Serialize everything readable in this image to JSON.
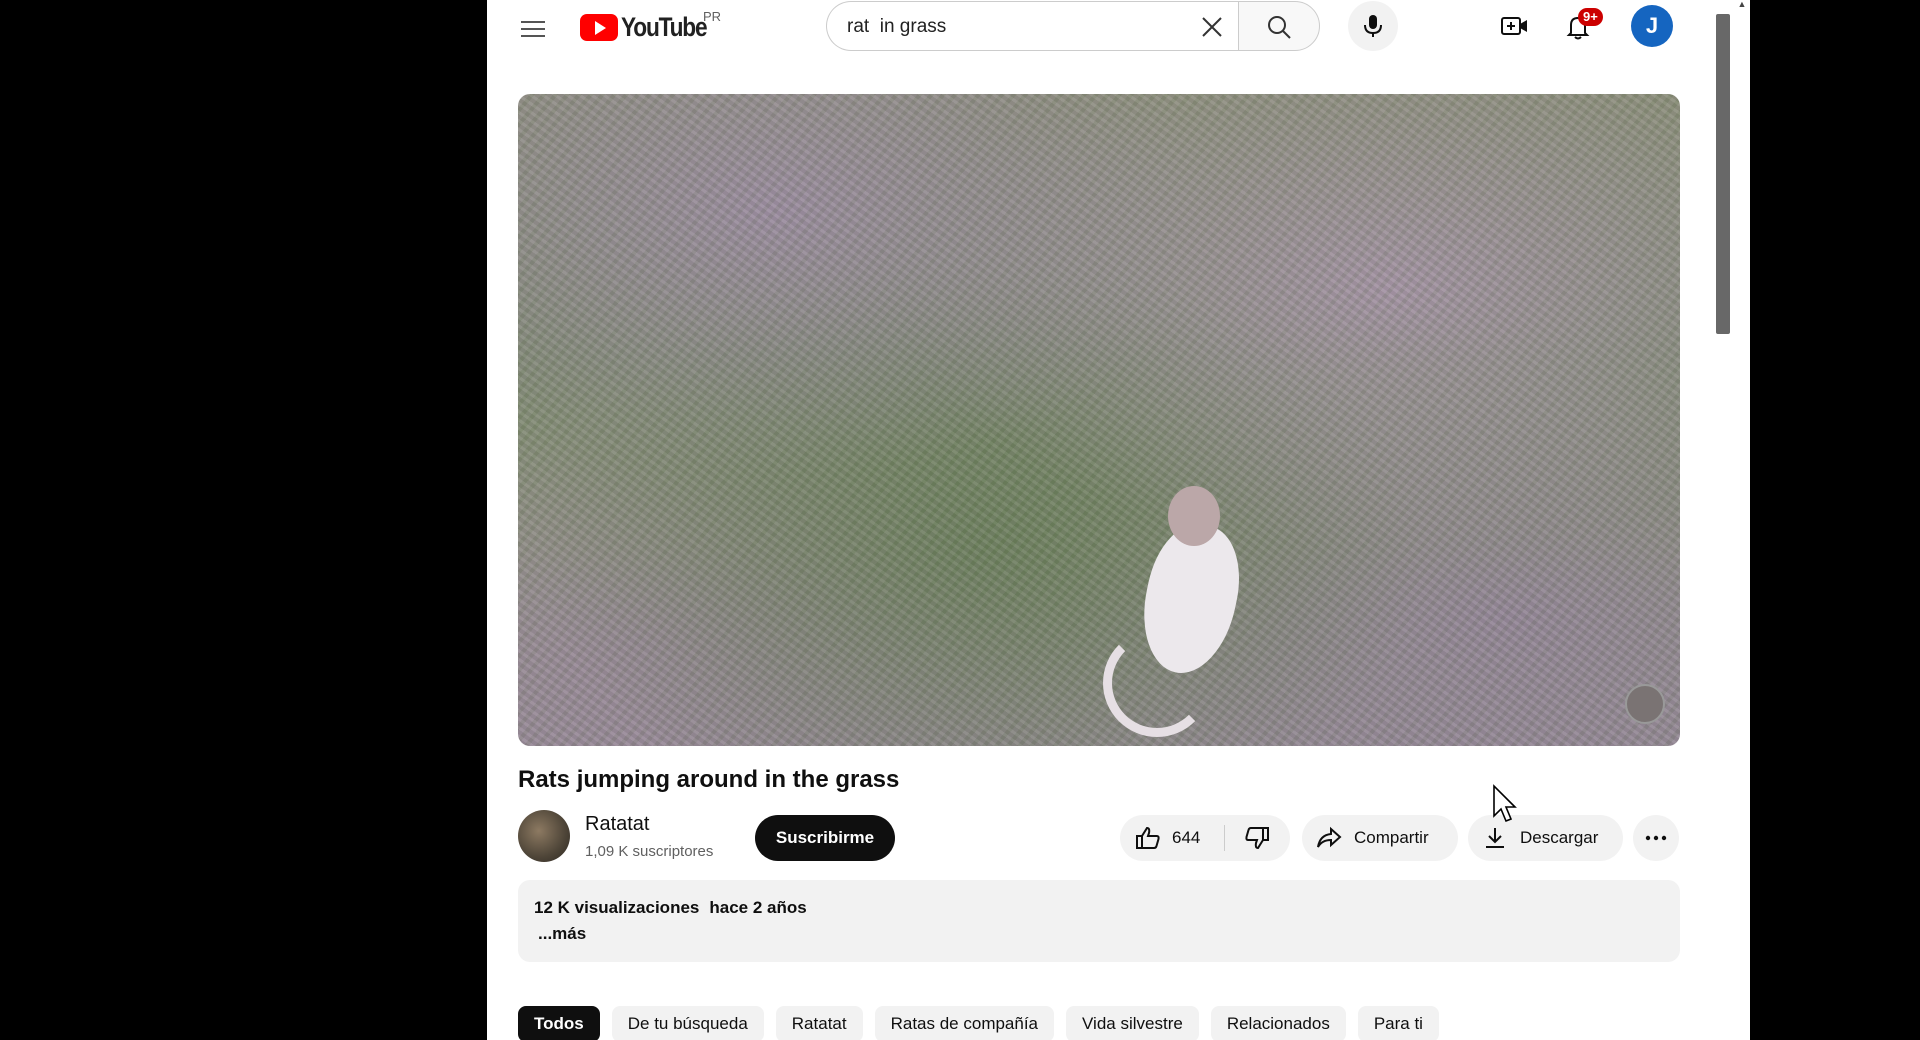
{
  "header": {
    "logo_text": "YouTube",
    "country_code": "PR",
    "search_value": "rat  in grass",
    "notification_badge": "9+",
    "avatar_letter": "J"
  },
  "video": {
    "title": "Rats jumping around in the grass",
    "channel": {
      "name": "Ratatat",
      "subscribers": "1,09 K suscriptores"
    },
    "subscribe_label": "Suscribirme",
    "likes": "644",
    "share_label": "Compartir",
    "download_label": "Descargar",
    "views": "12 K visualizaciones",
    "published": "hace 2 años",
    "more_label": "...más"
  },
  "chips": [
    "Todos",
    "De tu búsqueda",
    "Ratatat",
    "Ratas de compañía",
    "Vida silvestre",
    "Relacionados",
    "Para ti"
  ],
  "colors": {
    "brand_red": "#ff0000",
    "avatar_blue": "#1565c0",
    "chip_active": "#0f0f0f"
  }
}
